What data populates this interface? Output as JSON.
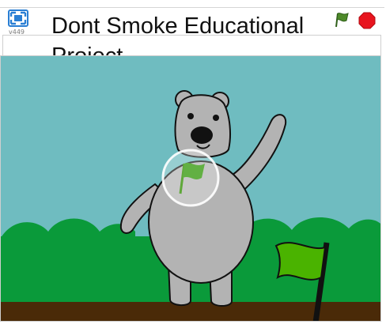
{
  "project": {
    "title": "Dont Smoke Educational Project",
    "version_label": "v449"
  },
  "controls": {
    "fullscreen_icon": "fullscreen-icon",
    "green_flag_icon": "green-flag-icon",
    "stop_icon": "stop-icon"
  },
  "colors": {
    "sky": "#6fbcc0",
    "hills": "#0a9a3a",
    "ground": "#4a2a08",
    "bear": "#b3b3b3",
    "flag": "#4ab300",
    "stop": "#e8141e"
  }
}
